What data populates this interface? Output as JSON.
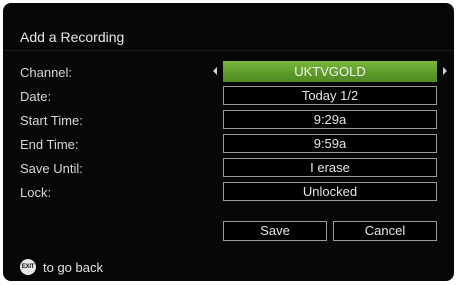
{
  "dialog": {
    "title": "Add a Recording"
  },
  "rows": [
    {
      "label": "Channel:",
      "value": "UKTVGOLD"
    },
    {
      "label": "Date:",
      "value": "Today 1/2"
    },
    {
      "label": "Start Time:",
      "value": "9:29a"
    },
    {
      "label": "End Time:",
      "value": "9:59a"
    },
    {
      "label": "Save Until:",
      "value": "I erase"
    },
    {
      "label": "Lock:",
      "value": "Unlocked"
    }
  ],
  "buttons": {
    "save": "Save",
    "cancel": "Cancel"
  },
  "footer": {
    "exit_icon_text": "EXIT",
    "hint": "to go back"
  },
  "colors": {
    "background": "#070707",
    "selected_field": "#6aa832",
    "border": "#9a9a9a",
    "text": "#e4e4e4"
  }
}
